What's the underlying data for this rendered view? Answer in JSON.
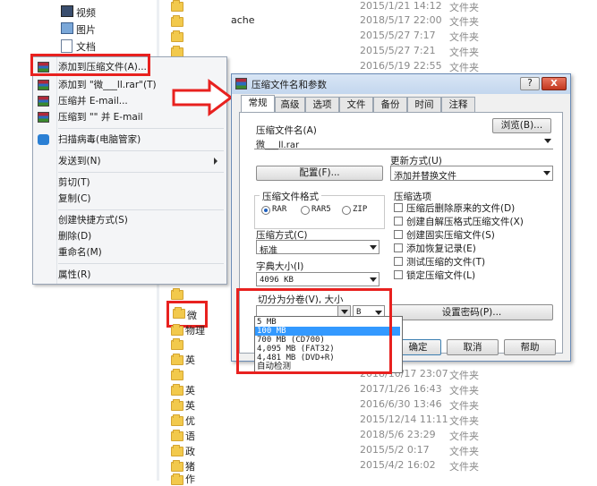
{
  "explorer": {
    "top_items": [
      {
        "label": "视频",
        "icon": "video-library-icon"
      },
      {
        "label": "图片",
        "icon": "picture-library-icon"
      },
      {
        "label": "文档",
        "icon": "document-library-icon"
      }
    ],
    "partial_text": "ache",
    "rows_top": [
      {
        "date": "2015/1/21 14:12",
        "type": "文件夹"
      },
      {
        "date": "2018/5/17 22:00",
        "type": "文件夹"
      },
      {
        "date": "2015/5/27 7:17",
        "type": "文件夹"
      },
      {
        "date": "2015/5/27 7:21",
        "type": "文件夹"
      },
      {
        "date": "2016/5/19 22:55",
        "type": "文件夹"
      }
    ],
    "rows_bottom": [
      {
        "name": "",
        "date": "2018/10/17 23:07",
        "type": "文件夹"
      },
      {
        "name": "英",
        "date": "2017/1/26 16:43",
        "type": "文件夹"
      },
      {
        "name": "英",
        "date": "2016/6/30 13:46",
        "type": "文件夹"
      },
      {
        "name": "优",
        "date": "2015/12/14 11:11",
        "type": "文件夹"
      },
      {
        "name": "语",
        "date": "2018/5/6 23:29",
        "type": "文件夹"
      },
      {
        "name": "政",
        "date": "2015/5/2 0:17",
        "type": "文件夹"
      },
      {
        "name": "猪",
        "date": "2015/4/2 16:02",
        "type": "文件夹"
      },
      {
        "name": "作",
        "date": "",
        "type": ""
      }
    ],
    "left_folders": [
      "微",
      "物理",
      "",
      "英",
      "英"
    ],
    "selected_folder": "微"
  },
  "context_menu": {
    "items": [
      {
        "label": "添加到压缩文件(A)...",
        "icon": "winrar-icon"
      },
      {
        "label": "添加到 \"微___ll.rar\"(T)",
        "icon": "winrar-icon"
      },
      {
        "label": "压缩并 E-mail...",
        "icon": "winrar-icon"
      },
      {
        "label": "压缩到 \"\" 并 E-mail",
        "icon": "winrar-icon"
      },
      {
        "label": "扫描病毒(电脑管家)",
        "icon": "shield-icon"
      },
      {
        "label": "发送到(N)",
        "icon": ""
      },
      {
        "label": "剪切(T)",
        "icon": ""
      },
      {
        "label": "复制(C)",
        "icon": ""
      },
      {
        "label": "创建快捷方式(S)",
        "icon": ""
      },
      {
        "label": "删除(D)",
        "icon": ""
      },
      {
        "label": "重命名(M)",
        "icon": ""
      },
      {
        "label": "属性(R)",
        "icon": ""
      }
    ]
  },
  "dialog": {
    "title": "压缩文件名和参数",
    "help_btn": "?",
    "close_btn": "X",
    "tabs": [
      "常规",
      "高级",
      "选项",
      "文件",
      "备份",
      "时间",
      "注释"
    ],
    "archive_name_label": "压缩文件名(A)",
    "archive_name_value": "微___ll.rar",
    "browse_button": "浏览(B)...",
    "update_label": "更新方式(U)",
    "update_value": "添加并替换文件",
    "config_button": "配置(F)...",
    "format_label": "压缩文件格式",
    "formats": [
      "RAR",
      "RAR5",
      "ZIP"
    ],
    "selected_format": "RAR",
    "options_label": "压缩选项",
    "options": [
      "压缩后删除原来的文件(D)",
      "创建自解压格式压缩文件(X)",
      "创建固实压缩文件(S)",
      "添加恢复记录(E)",
      "测试压缩的文件(T)",
      "锁定压缩文件(L)"
    ],
    "method_label": "压缩方式(C)",
    "method_value": "标准",
    "dict_label": "字典大小(I)",
    "dict_value": "4096 KB",
    "split_label": "切分为分卷(V), 大小",
    "split_value": "",
    "split_unit": "B",
    "password_button": "设置密码(P)...",
    "split_options": [
      "5 MB",
      "100 MB",
      "700 MB  (CD700)",
      "4,095 MB  (FAT32)",
      "4,481 MB  (DVD+R)",
      "自动检测"
    ],
    "split_selected_index": 1,
    "ok_button": "确定",
    "cancel_button": "取消",
    "help_button": "帮助"
  },
  "colors": {
    "highlight_red": "#e8211f",
    "selection_blue": "#3399ff"
  }
}
